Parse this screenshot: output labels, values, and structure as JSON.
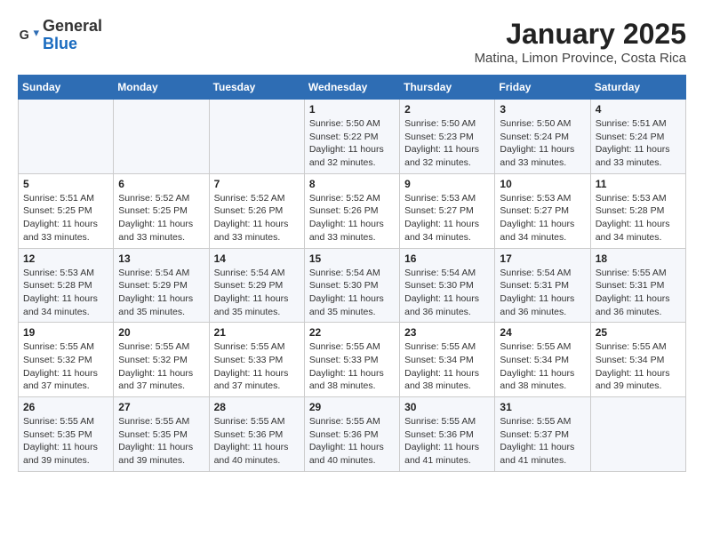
{
  "header": {
    "logo_general": "General",
    "logo_blue": "Blue",
    "title": "January 2025",
    "subtitle": "Matina, Limon Province, Costa Rica"
  },
  "weekdays": [
    "Sunday",
    "Monday",
    "Tuesday",
    "Wednesday",
    "Thursday",
    "Friday",
    "Saturday"
  ],
  "weeks": [
    [
      {
        "day": "",
        "sunrise": "",
        "sunset": "",
        "daylight": ""
      },
      {
        "day": "",
        "sunrise": "",
        "sunset": "",
        "daylight": ""
      },
      {
        "day": "",
        "sunrise": "",
        "sunset": "",
        "daylight": ""
      },
      {
        "day": "1",
        "sunrise": "Sunrise: 5:50 AM",
        "sunset": "Sunset: 5:22 PM",
        "daylight": "Daylight: 11 hours and 32 minutes."
      },
      {
        "day": "2",
        "sunrise": "Sunrise: 5:50 AM",
        "sunset": "Sunset: 5:23 PM",
        "daylight": "Daylight: 11 hours and 32 minutes."
      },
      {
        "day": "3",
        "sunrise": "Sunrise: 5:50 AM",
        "sunset": "Sunset: 5:24 PM",
        "daylight": "Daylight: 11 hours and 33 minutes."
      },
      {
        "day": "4",
        "sunrise": "Sunrise: 5:51 AM",
        "sunset": "Sunset: 5:24 PM",
        "daylight": "Daylight: 11 hours and 33 minutes."
      }
    ],
    [
      {
        "day": "5",
        "sunrise": "Sunrise: 5:51 AM",
        "sunset": "Sunset: 5:25 PM",
        "daylight": "Daylight: 11 hours and 33 minutes."
      },
      {
        "day": "6",
        "sunrise": "Sunrise: 5:52 AM",
        "sunset": "Sunset: 5:25 PM",
        "daylight": "Daylight: 11 hours and 33 minutes."
      },
      {
        "day": "7",
        "sunrise": "Sunrise: 5:52 AM",
        "sunset": "Sunset: 5:26 PM",
        "daylight": "Daylight: 11 hours and 33 minutes."
      },
      {
        "day": "8",
        "sunrise": "Sunrise: 5:52 AM",
        "sunset": "Sunset: 5:26 PM",
        "daylight": "Daylight: 11 hours and 33 minutes."
      },
      {
        "day": "9",
        "sunrise": "Sunrise: 5:53 AM",
        "sunset": "Sunset: 5:27 PM",
        "daylight": "Daylight: 11 hours and 34 minutes."
      },
      {
        "day": "10",
        "sunrise": "Sunrise: 5:53 AM",
        "sunset": "Sunset: 5:27 PM",
        "daylight": "Daylight: 11 hours and 34 minutes."
      },
      {
        "day": "11",
        "sunrise": "Sunrise: 5:53 AM",
        "sunset": "Sunset: 5:28 PM",
        "daylight": "Daylight: 11 hours and 34 minutes."
      }
    ],
    [
      {
        "day": "12",
        "sunrise": "Sunrise: 5:53 AM",
        "sunset": "Sunset: 5:28 PM",
        "daylight": "Daylight: 11 hours and 34 minutes."
      },
      {
        "day": "13",
        "sunrise": "Sunrise: 5:54 AM",
        "sunset": "Sunset: 5:29 PM",
        "daylight": "Daylight: 11 hours and 35 minutes."
      },
      {
        "day": "14",
        "sunrise": "Sunrise: 5:54 AM",
        "sunset": "Sunset: 5:29 PM",
        "daylight": "Daylight: 11 hours and 35 minutes."
      },
      {
        "day": "15",
        "sunrise": "Sunrise: 5:54 AM",
        "sunset": "Sunset: 5:30 PM",
        "daylight": "Daylight: 11 hours and 35 minutes."
      },
      {
        "day": "16",
        "sunrise": "Sunrise: 5:54 AM",
        "sunset": "Sunset: 5:30 PM",
        "daylight": "Daylight: 11 hours and 36 minutes."
      },
      {
        "day": "17",
        "sunrise": "Sunrise: 5:54 AM",
        "sunset": "Sunset: 5:31 PM",
        "daylight": "Daylight: 11 hours and 36 minutes."
      },
      {
        "day": "18",
        "sunrise": "Sunrise: 5:55 AM",
        "sunset": "Sunset: 5:31 PM",
        "daylight": "Daylight: 11 hours and 36 minutes."
      }
    ],
    [
      {
        "day": "19",
        "sunrise": "Sunrise: 5:55 AM",
        "sunset": "Sunset: 5:32 PM",
        "daylight": "Daylight: 11 hours and 37 minutes."
      },
      {
        "day": "20",
        "sunrise": "Sunrise: 5:55 AM",
        "sunset": "Sunset: 5:32 PM",
        "daylight": "Daylight: 11 hours and 37 minutes."
      },
      {
        "day": "21",
        "sunrise": "Sunrise: 5:55 AM",
        "sunset": "Sunset: 5:33 PM",
        "daylight": "Daylight: 11 hours and 37 minutes."
      },
      {
        "day": "22",
        "sunrise": "Sunrise: 5:55 AM",
        "sunset": "Sunset: 5:33 PM",
        "daylight": "Daylight: 11 hours and 38 minutes."
      },
      {
        "day": "23",
        "sunrise": "Sunrise: 5:55 AM",
        "sunset": "Sunset: 5:34 PM",
        "daylight": "Daylight: 11 hours and 38 minutes."
      },
      {
        "day": "24",
        "sunrise": "Sunrise: 5:55 AM",
        "sunset": "Sunset: 5:34 PM",
        "daylight": "Daylight: 11 hours and 38 minutes."
      },
      {
        "day": "25",
        "sunrise": "Sunrise: 5:55 AM",
        "sunset": "Sunset: 5:34 PM",
        "daylight": "Daylight: 11 hours and 39 minutes."
      }
    ],
    [
      {
        "day": "26",
        "sunrise": "Sunrise: 5:55 AM",
        "sunset": "Sunset: 5:35 PM",
        "daylight": "Daylight: 11 hours and 39 minutes."
      },
      {
        "day": "27",
        "sunrise": "Sunrise: 5:55 AM",
        "sunset": "Sunset: 5:35 PM",
        "daylight": "Daylight: 11 hours and 39 minutes."
      },
      {
        "day": "28",
        "sunrise": "Sunrise: 5:55 AM",
        "sunset": "Sunset: 5:36 PM",
        "daylight": "Daylight: 11 hours and 40 minutes."
      },
      {
        "day": "29",
        "sunrise": "Sunrise: 5:55 AM",
        "sunset": "Sunset: 5:36 PM",
        "daylight": "Daylight: 11 hours and 40 minutes."
      },
      {
        "day": "30",
        "sunrise": "Sunrise: 5:55 AM",
        "sunset": "Sunset: 5:36 PM",
        "daylight": "Daylight: 11 hours and 41 minutes."
      },
      {
        "day": "31",
        "sunrise": "Sunrise: 5:55 AM",
        "sunset": "Sunset: 5:37 PM",
        "daylight": "Daylight: 11 hours and 41 minutes."
      },
      {
        "day": "",
        "sunrise": "",
        "sunset": "",
        "daylight": ""
      }
    ]
  ]
}
